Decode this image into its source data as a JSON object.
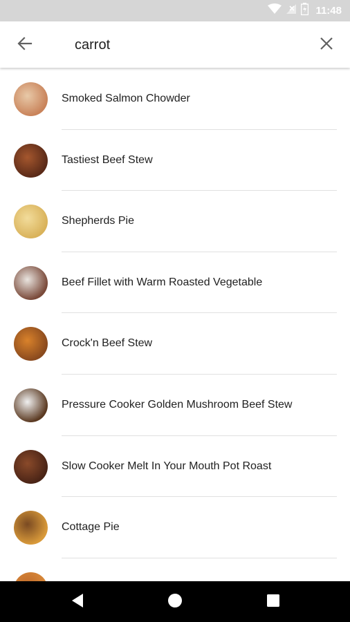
{
  "status_bar": {
    "time": "11:48",
    "icons": [
      "wifi-icon",
      "signal-icon",
      "battery-icon"
    ]
  },
  "search": {
    "query": "carrot",
    "back_icon": "arrow-back-icon",
    "clear_icon": "close-icon"
  },
  "results": [
    {
      "title": "Smoked Salmon Chowder",
      "thumb_colors": [
        "#c9835a",
        "#e8c9a8"
      ]
    },
    {
      "title": "Tastiest Beef Stew",
      "thumb_colors": [
        "#5a2a18",
        "#a5572e"
      ]
    },
    {
      "title": "Shepherds Pie",
      "thumb_colors": [
        "#d9b25a",
        "#f2dc9b"
      ]
    },
    {
      "title": "Beef Fillet with Warm Roasted Vegetable",
      "thumb_colors": [
        "#7a4a3a",
        "#e9e4df"
      ]
    },
    {
      "title": "Crock'n Beef Stew",
      "thumb_colors": [
        "#8a4a1e",
        "#d9822b"
      ]
    },
    {
      "title": "Pressure Cooker Golden Mushroom Beef Stew",
      "thumb_colors": [
        "#5b3a22",
        "#f0f0f0"
      ]
    },
    {
      "title": "Slow Cooker Melt In Your Mouth Pot Roast",
      "thumb_colors": [
        "#4a2416",
        "#8a4a2a"
      ]
    },
    {
      "title": "Cottage Pie",
      "thumb_colors": [
        "#d99a3a",
        "#7a4a22"
      ]
    },
    {
      "title": "",
      "thumb_colors": [
        "#d98a3a",
        "#c06a2a"
      ]
    }
  ],
  "nav_bar": {
    "back": "nav-back-icon",
    "home": "nav-home-icon",
    "recents": "nav-recents-icon"
  }
}
